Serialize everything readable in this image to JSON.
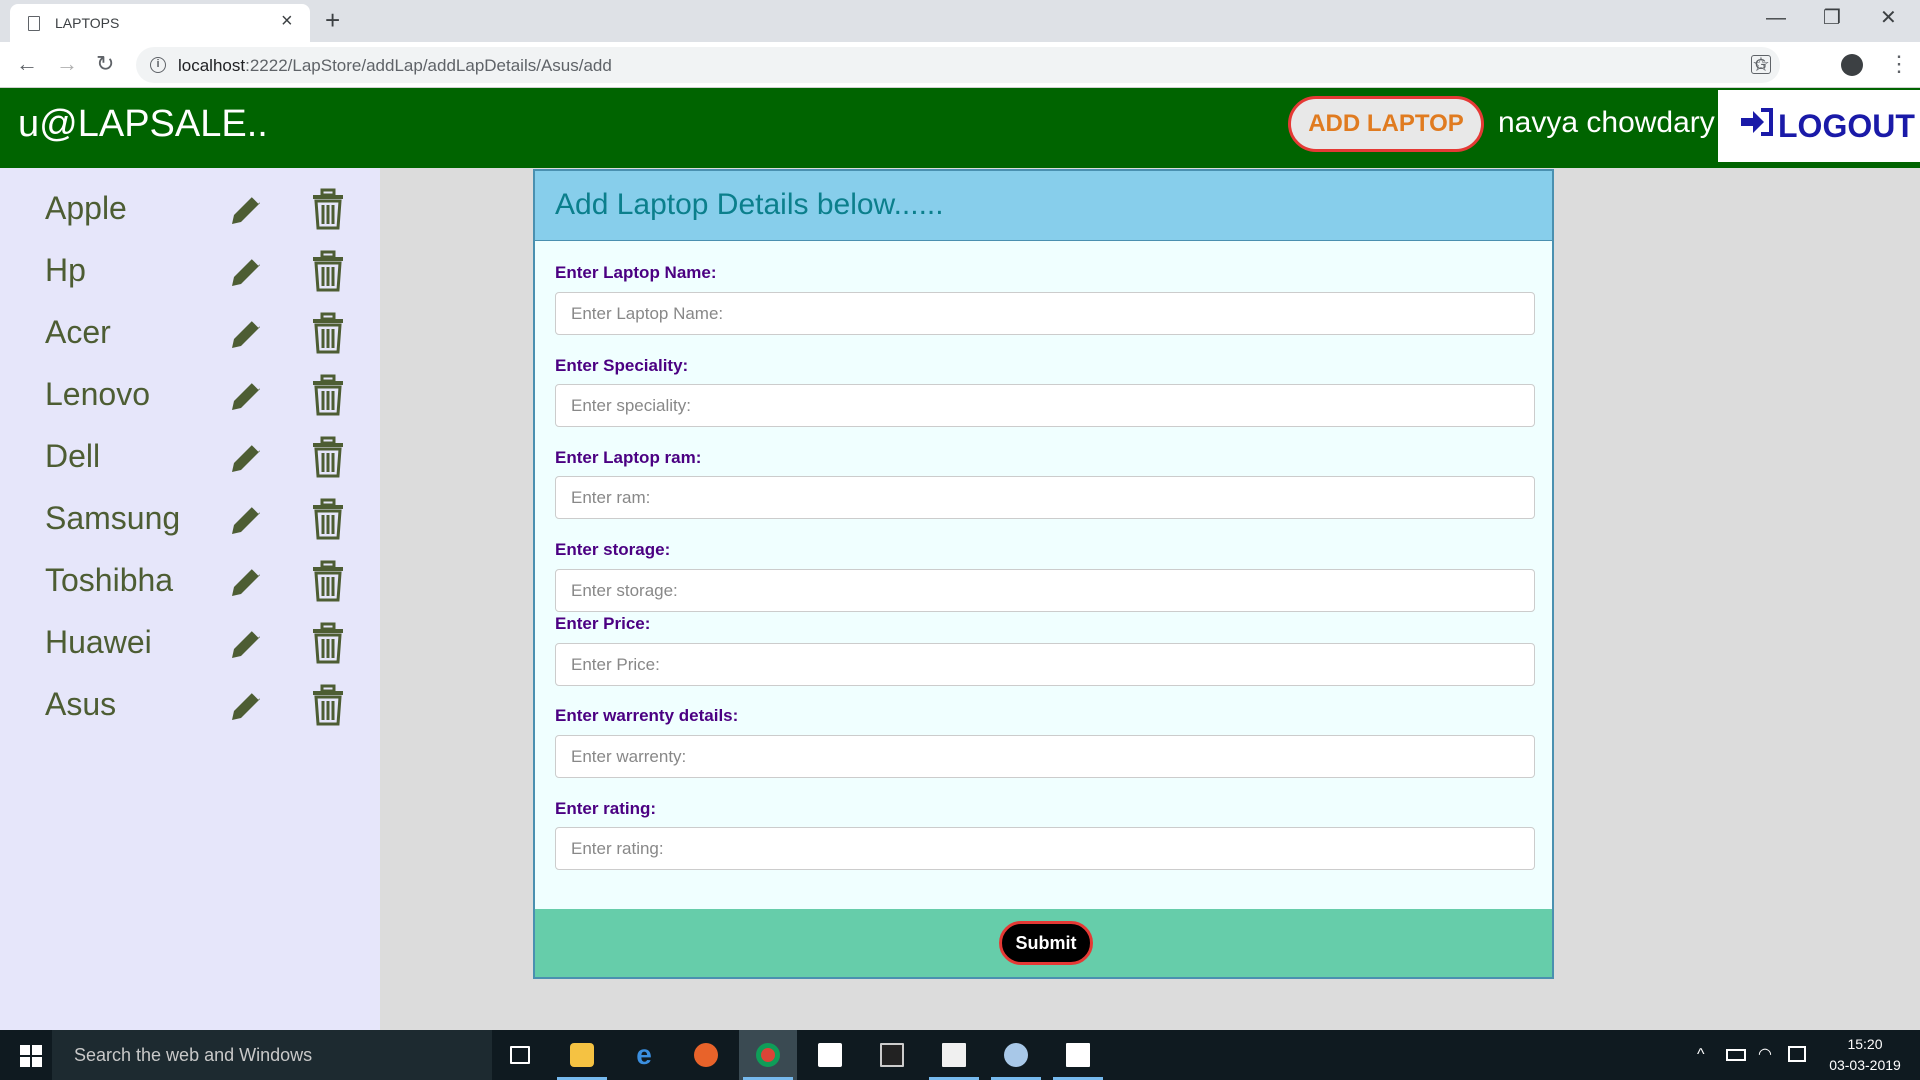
{
  "browser": {
    "tab_title": "LAPTOPS",
    "url_host": "localhost",
    "url_path": ":2222/LapStore/addLap/addLapDetails/Asus/add"
  },
  "header": {
    "brand": "u@LAPSALE..",
    "add_button": "ADD LAPTOP",
    "username": "navya chowdary",
    "logout": "LOGOUT"
  },
  "sidebar": {
    "brands": [
      {
        "name": "Apple"
      },
      {
        "name": "Hp"
      },
      {
        "name": "Acer"
      },
      {
        "name": "Lenovo"
      },
      {
        "name": "Dell"
      },
      {
        "name": "Samsung"
      },
      {
        "name": "Toshibha"
      },
      {
        "name": "Huawei"
      },
      {
        "name": "Asus"
      }
    ]
  },
  "form": {
    "title": "Add Laptop Details below......",
    "fields": [
      {
        "label": "Enter Laptop Name:",
        "placeholder": "Enter Laptop Name:",
        "value": ""
      },
      {
        "label": "Enter Speciality:",
        "placeholder": "Enter speciality:",
        "value": ""
      },
      {
        "label": "Enter Laptop ram:",
        "placeholder": "Enter ram:",
        "value": ""
      },
      {
        "label": "Enter storage:",
        "placeholder": "Enter storage:",
        "value": ""
      },
      {
        "label": "Enter Price:",
        "placeholder": "Enter Price:",
        "value": ""
      },
      {
        "label": "Enter warrenty details:",
        "placeholder": "Enter warrenty:",
        "value": ""
      },
      {
        "label": "Enter rating:",
        "placeholder": "Enter rating:",
        "value": ""
      }
    ],
    "submit": "Submit"
  },
  "taskbar": {
    "search_placeholder": "Search the web and Windows",
    "time": "15:20",
    "date": "03-03-2019"
  },
  "colors": {
    "header_bg": "#006400",
    "sidebar_bg": "#e6e6fa",
    "card_head_bg": "#87ceeb",
    "card_body_bg": "#f0ffff",
    "card_foot_bg": "#66cdaa",
    "label_color": "#4b0082",
    "brand_text": "#4d5d33"
  }
}
